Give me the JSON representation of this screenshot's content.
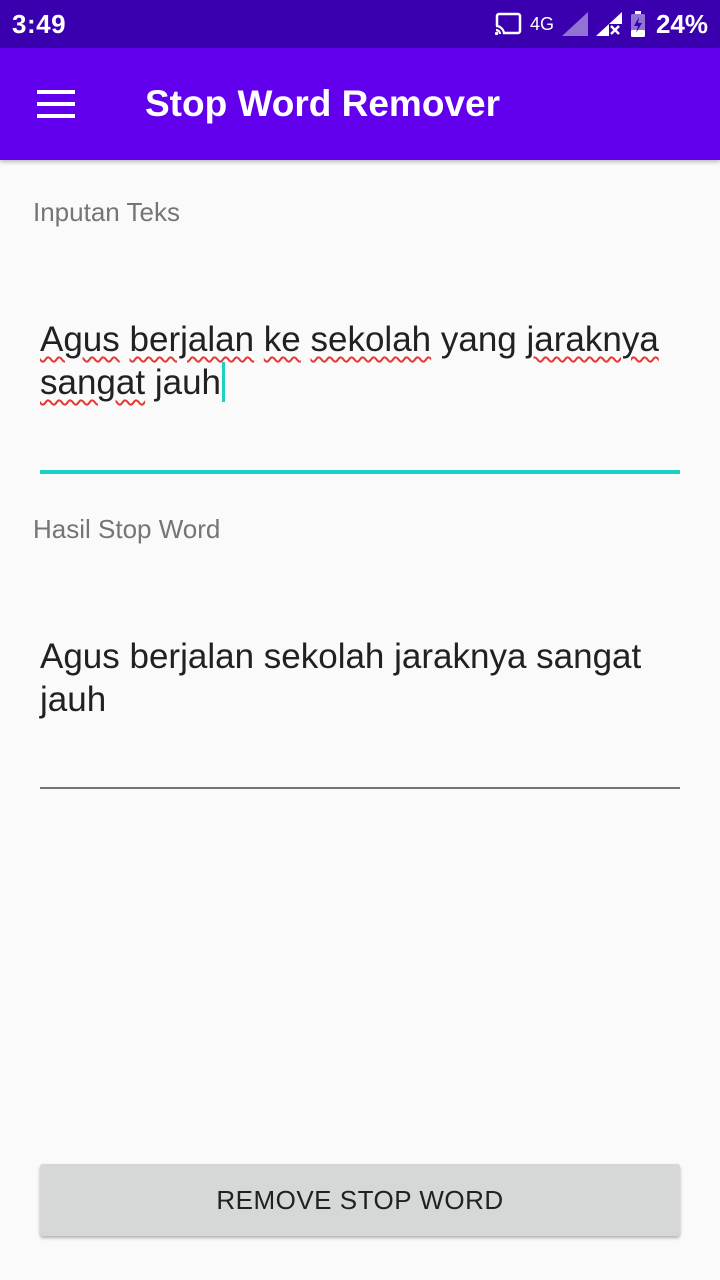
{
  "status_bar": {
    "time": "3:49",
    "network": "4G",
    "battery_percent": "24%",
    "icons": [
      "cast-icon",
      "signal-icon",
      "signal-no-data-icon",
      "battery-charging-icon"
    ]
  },
  "app_bar": {
    "menu_icon": "hamburger-menu-icon",
    "title": "Stop Word Remover"
  },
  "input": {
    "label": "Inputan Teks",
    "words": [
      "Agus",
      "berjalan",
      "ke",
      "sekolah",
      "yang",
      "jaraknya",
      "sangat",
      "jauh"
    ],
    "underline_color": "#1ccfc9"
  },
  "result": {
    "label": "Hasil Stop Word",
    "text": "Agus berjalan sekolah jaraknya sangat jauh",
    "underline_color": "#757575"
  },
  "action": {
    "button_label": "REMOVE STOP WORD"
  },
  "colors": {
    "status_bar": "#3a00b0",
    "app_bar": "#6200ee",
    "accent": "#1ccfc9",
    "spell_error": "#e53935"
  }
}
